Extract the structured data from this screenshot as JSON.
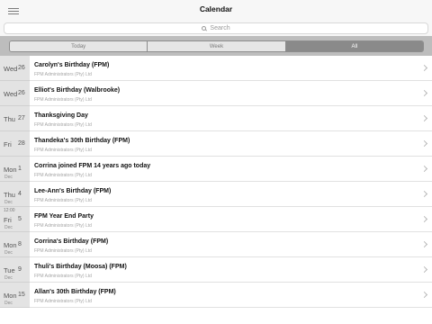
{
  "header": {
    "title": "Calendar"
  },
  "search": {
    "placeholder": "Search"
  },
  "segments": [
    "Today",
    "Week",
    "All"
  ],
  "active_segment": "All",
  "events": [
    {
      "dow": "Wed",
      "day": "26",
      "time": "",
      "month": "",
      "title": "Carolyn's Birthday (FPM)",
      "subtitle": "FPM Administrators (Pty) Ltd"
    },
    {
      "dow": "Wed",
      "day": "26",
      "time": "",
      "month": "",
      "title": "Elliot's Birthday (Walbrooke)",
      "subtitle": "FPM Administrators (Pty) Ltd"
    },
    {
      "dow": "Thu",
      "day": "27",
      "time": "",
      "month": "",
      "title": "Thanksgiving Day",
      "subtitle": "FPM Administrators (Pty) Ltd"
    },
    {
      "dow": "Fri",
      "day": "28",
      "time": "",
      "month": "",
      "title": "Thandeka's 30th Birthday (FPM)",
      "subtitle": "FPM Administrators (Pty) Ltd"
    },
    {
      "dow": "Mon",
      "day": "1",
      "time": "",
      "month": "Dec",
      "title": "Corrina joined FPM 14 years ago today",
      "subtitle": "FPM Administrators (Pty) Ltd"
    },
    {
      "dow": "Thu",
      "day": "4",
      "time": "",
      "month": "Dec",
      "title": "Lee-Ann's Birthday (FPM)",
      "subtitle": "FPM Administrators (Pty) Ltd"
    },
    {
      "dow": "Fri",
      "day": "5",
      "time": "12:00",
      "month": "Dec",
      "title": "FPM Year End Party",
      "subtitle": "FPM Administrators (Pty) Ltd"
    },
    {
      "dow": "Mon",
      "day": "8",
      "time": "",
      "month": "Dec",
      "title": "Corrina's Birthday (FPM)",
      "subtitle": "FPM Administrators (Pty) Ltd"
    },
    {
      "dow": "Tue",
      "day": "9",
      "time": "",
      "month": "Dec",
      "title": "Thuli's Birthday (Moosa) (FPM)",
      "subtitle": "FPM Administrators (Pty) Ltd"
    },
    {
      "dow": "Mon",
      "day": "15",
      "time": "",
      "month": "Dec",
      "title": "Allan's 30th Birthday (FPM)",
      "subtitle": "FPM Administrators (Pty) Ltd"
    }
  ]
}
